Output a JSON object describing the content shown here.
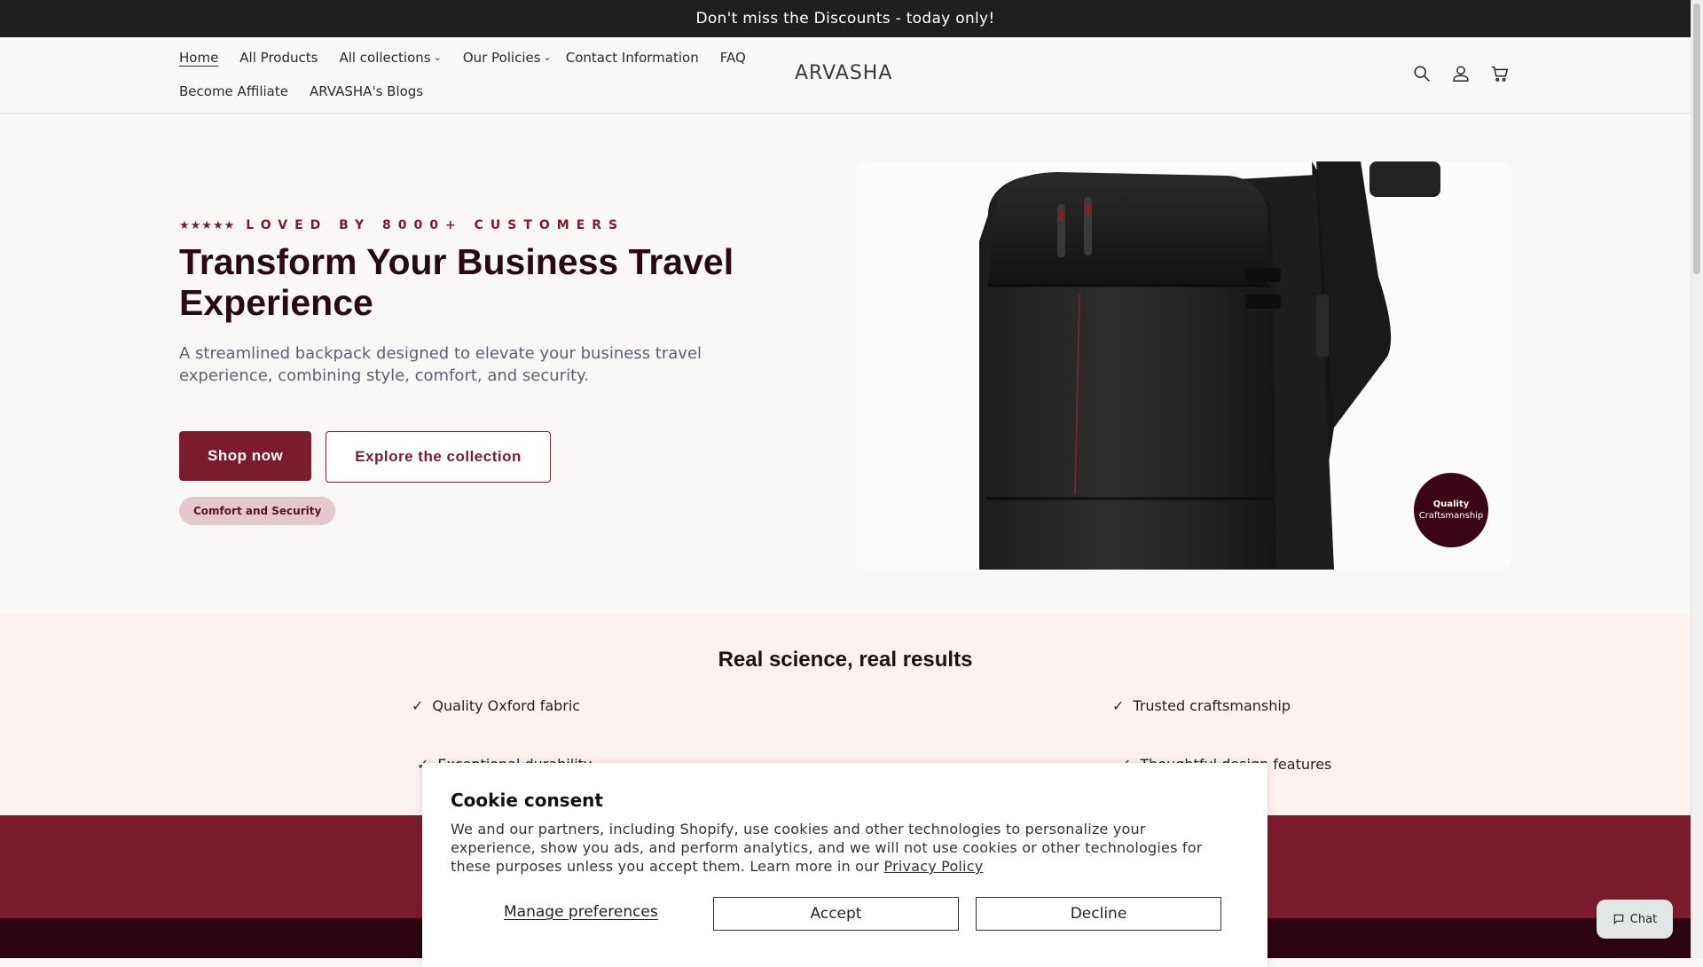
{
  "announcement": "Don't miss the Discounts - today only!",
  "header": {
    "brand": "ARVASHA",
    "nav_row1": [
      {
        "label": "Home",
        "active": true
      },
      {
        "label": "All Products"
      },
      {
        "label": "All collections",
        "dropdown": true
      },
      {
        "label": "Our Policies",
        "dropdown": true
      },
      {
        "label": "Contact Information"
      },
      {
        "label": "FAQ"
      }
    ],
    "nav_row2": [
      {
        "label": "Become Affiliate"
      },
      {
        "label": "ARVASHA's Blogs"
      }
    ],
    "icons": [
      "search-icon",
      "account-icon",
      "cart-icon"
    ]
  },
  "hero": {
    "stars": "★★★★★",
    "eyebrow": "LOVED BY 8000+ CUSTOMERS",
    "title": "Transform Your Business Travel Experience",
    "description": "A streamlined backpack designed to elevate your business travel experience, combining style, comfort, and security.",
    "primary_button": "Shop now",
    "secondary_button": "Explore the collection",
    "pill": "Comfort and Security",
    "badge_line1": "Quality",
    "badge_line2": "Craftsmanship"
  },
  "science": {
    "title": "Real science, real results",
    "features": [
      "Quality Oxford fabric",
      "Trusted craftsmanship",
      "Exceptional durability",
      "Thoughtful design features"
    ]
  },
  "cookie": {
    "title": "Cookie consent",
    "text": "We and our partners, including Shopify, use cookies and other technologies to personalize your experience, show you ads, and perform analytics, and we will not use cookies or other technologies for these purposes unless you accept them. Learn more in our ",
    "link": "Privacy Policy",
    "manage": "Manage preferences",
    "accept": "Accept",
    "decline": "Decline"
  },
  "chat": {
    "label": "Chat"
  },
  "colors": {
    "accent": "#7b1b30",
    "dark": "#2c0410",
    "pill": "#e4c8cd"
  }
}
